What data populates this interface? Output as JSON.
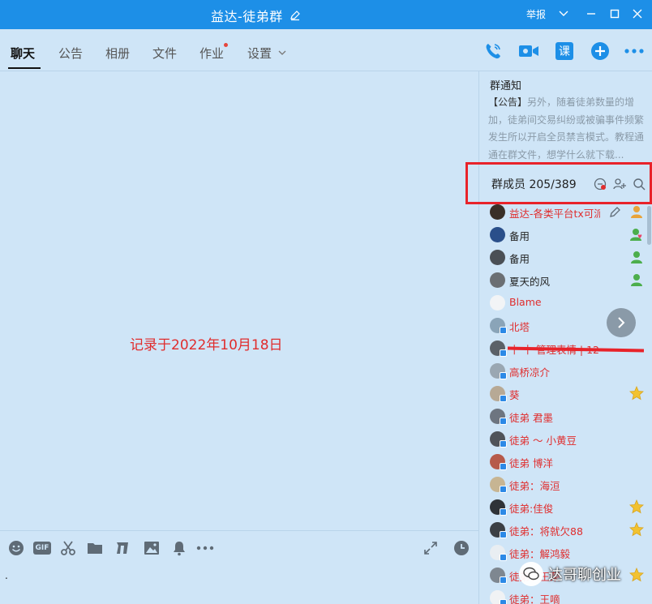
{
  "window": {
    "title": "益达-徒弟群",
    "report_label": "举报"
  },
  "tabs": [
    {
      "label": "聊天",
      "active": true
    },
    {
      "label": "公告"
    },
    {
      "label": "相册"
    },
    {
      "label": "文件"
    },
    {
      "label": "作业",
      "dot": true
    },
    {
      "label": "设置"
    }
  ],
  "toolbar": {
    "course_label": "课"
  },
  "chat": {
    "record_text": "记录于2022年10月18日"
  },
  "input": {
    "gif_label": "GIF",
    "text": "."
  },
  "notice": {
    "title": "群通知",
    "tag": "【公告】",
    "body": "另外，随着徒弟数量的增加，徒弟间交易纠纷或被骗事件频繁发生所以开启全员禁言模式。教程通通在群文件，想学什么就下载..."
  },
  "members_header": {
    "label": "群成员 205/389"
  },
  "members": [
    {
      "name": "益达-各类平台tx可派",
      "color": "red",
      "role": "owner",
      "editable": true
    },
    {
      "name": "备用",
      "color": "black",
      "role": "admin-heart"
    },
    {
      "name": "备用",
      "color": "black",
      "role": "admin"
    },
    {
      "name": "夏天的风",
      "color": "black",
      "role": "admin"
    },
    {
      "name": "Blame",
      "color": "red"
    },
    {
      "name": "北塔",
      "color": "red"
    },
    {
      "name": "十 十 管理表情 | 1264700...",
      "color": "red"
    },
    {
      "name": "高桥凉介",
      "color": "red"
    },
    {
      "name": "葵",
      "color": "red",
      "role": "star"
    },
    {
      "name": "徒弟  君墨",
      "color": "red"
    },
    {
      "name": "徒弟 ～ 小黄豆",
      "color": "red"
    },
    {
      "name": "徒弟 博洋",
      "color": "red"
    },
    {
      "name": "徒弟：海洹",
      "color": "red"
    },
    {
      "name": "徒弟:佳俊",
      "color": "red",
      "role": "star"
    },
    {
      "name": "徒弟：将就欠88",
      "color": "red",
      "role": "star"
    },
    {
      "name": "徒弟：解鸿毅",
      "color": "red"
    },
    {
      "name": "徒弟：王荣",
      "color": "red",
      "role": "star"
    },
    {
      "name": "徒弟：王嘀",
      "color": "red"
    }
  ],
  "watermark": {
    "text": "达哥聊创业"
  },
  "colors": {
    "titlebar": "#1d8fe7",
    "panel_bg": "#cfe5f7",
    "accent": "#1d8fe7",
    "red": "#e02d2d"
  }
}
